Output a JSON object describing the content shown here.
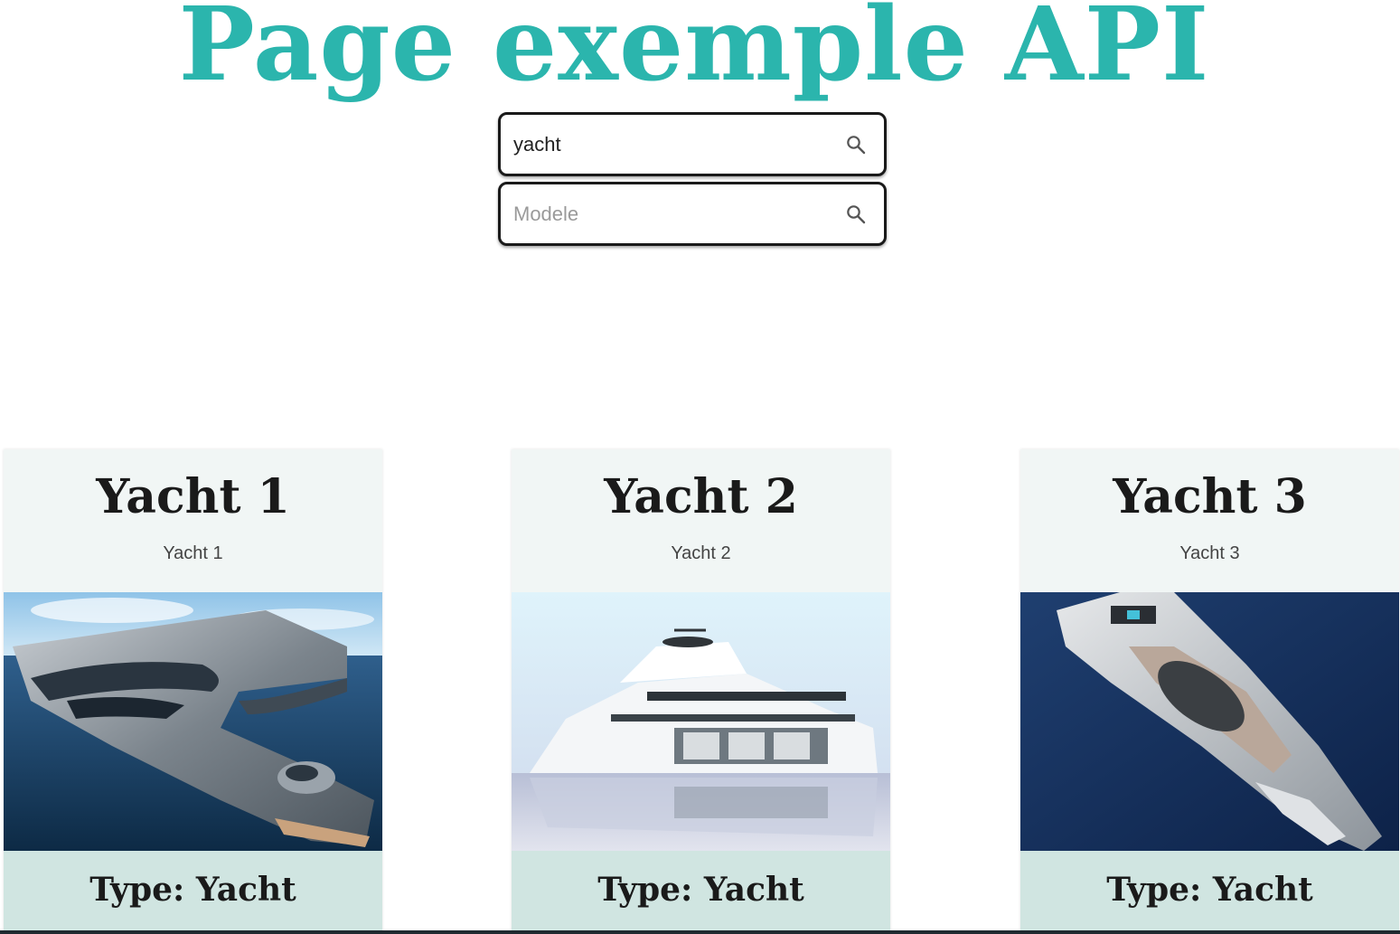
{
  "page": {
    "title": "Page exemple API",
    "accent_color": "#2bb5ad"
  },
  "search": {
    "primary": {
      "value": "yacht",
      "placeholder": ""
    },
    "secondary": {
      "value": "",
      "placeholder": "Modele"
    },
    "icon": "search-icon"
  },
  "cards": [
    {
      "title": "Yacht 1",
      "subtitle": "Yacht 1",
      "type_label": "Type: Yacht",
      "image": "futuristic-yacht-open-sea"
    },
    {
      "title": "Yacht 2",
      "subtitle": "Yacht 2",
      "type_label": "Type: Yacht",
      "image": "white-superyacht-with-helicopter"
    },
    {
      "title": "Yacht 3",
      "subtitle": "Yacht 3",
      "type_label": "Type: Yacht",
      "image": "yacht-aerial-view-deep-blue-water"
    }
  ]
}
